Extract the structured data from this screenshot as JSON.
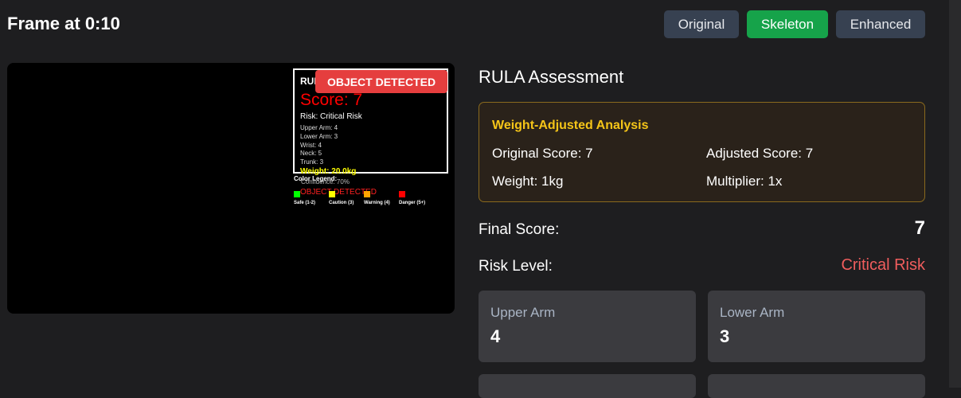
{
  "header": {
    "title": "Frame at 0:10",
    "view_modes": [
      {
        "label": "Original",
        "active": false
      },
      {
        "label": "Skeleton",
        "active": true
      },
      {
        "label": "Enhanced",
        "active": false
      }
    ]
  },
  "frame_overlay": {
    "title": "RULA",
    "score": "Score: 7",
    "risk": "Risk: Critical Risk",
    "metrics": [
      "Upper Arm: 4",
      "Lower Arm: 3",
      "Wrist: 4",
      "Neck: 5",
      "Trunk: 3"
    ],
    "weight": "Weight: 20.0kg",
    "badge": "OBJECT DETECTED",
    "legend_title": "Color Legend:",
    "confidence": "Confidence: 70%",
    "object_text": "OBJECT DETECTED",
    "legend": [
      {
        "label": "Safe (1-2)",
        "color": "#00ff00"
      },
      {
        "label": "Caution (3)",
        "color": "#ffff00"
      },
      {
        "label": "Warning (4)",
        "color": "#ffa500"
      },
      {
        "label": "Danger (5+)",
        "color": "#ff0000"
      }
    ]
  },
  "assessment": {
    "title": "RULA Assessment",
    "weight_analysis": {
      "title": "Weight-Adjusted Analysis",
      "original_score": "Original Score: 7",
      "adjusted_score": "Adjusted Score: 7",
      "weight": "Weight: 1kg",
      "multiplier": "Multiplier: 1x"
    },
    "final_score_label": "Final Score:",
    "final_score": "7",
    "risk_level_label": "Risk Level:",
    "risk_level": "Critical Risk",
    "risk_color": "#f05d5d",
    "body_scores": [
      {
        "label": "Upper Arm",
        "value": "4"
      },
      {
        "label": "Lower Arm",
        "value": "3"
      }
    ]
  },
  "colors": {
    "active_toggle": "#16a34a",
    "inactive_toggle": "#374151",
    "weight_title": "#f5c518",
    "badge": "#e53e3e"
  }
}
